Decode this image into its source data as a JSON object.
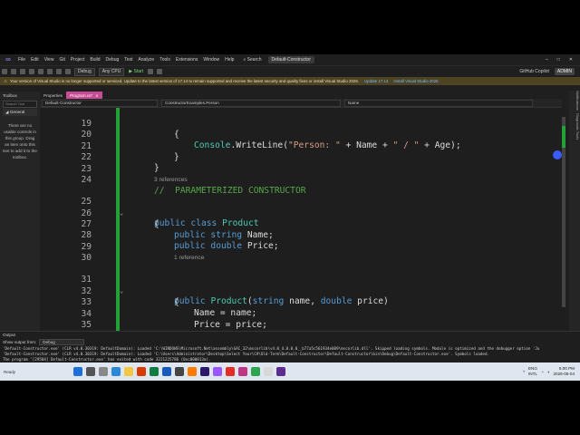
{
  "menu": {
    "items": [
      "File",
      "Edit",
      "View",
      "Git",
      "Project",
      "Build",
      "Debug",
      "Test",
      "Analyze",
      "Tools",
      "Extensions",
      "Window",
      "Help"
    ],
    "search": "Search",
    "solution_title": "Default-Constructor"
  },
  "toolbar": {
    "config": "Debug",
    "platform": "Any CPU",
    "start": "Start",
    "copilot": "GitHub Copilot",
    "user": "ADMIN"
  },
  "warning": {
    "message": "Your version of Visual Studio is no longer supported or serviced. Update to the latest version of 17.14 to remain supported and receive the latest security and quality fixes or install Visual Studio 2026.",
    "link1": "Update 17.14",
    "link2": "Install Visual Studio 2026"
  },
  "toolbox": {
    "title": "Toolbox",
    "search_placeholder": "Search Tool",
    "group": "General",
    "empty_message": "There are no usable controls in this group. Drag an item onto this text to add it to the toolbox."
  },
  "tabs": [
    {
      "label": "Properties"
    },
    {
      "label": "Program.cs*"
    }
  ],
  "navbar": {
    "project": "Default-Constructor",
    "class": "ConstructorExamples.Person",
    "member": "Name"
  },
  "editor": {
    "lines": [
      {
        "n": "19",
        "code": "{"
      },
      {
        "n": "20",
        "code": "Console.WriteLine(\"Person: \" + Name + \" / \" + Age);"
      },
      {
        "n": "21",
        "code": "}"
      },
      {
        "n": "22",
        "code": "}"
      },
      {
        "n": "23",
        "code": ""
      },
      {
        "n": "24",
        "code": "//  PARAMETERIZED CONSTRUCTOR"
      },
      {
        "n": "25",
        "code": "public class Product"
      },
      {
        "n": "26",
        "code": "{"
      },
      {
        "n": "27",
        "code": "public string Name;"
      },
      {
        "n": "28",
        "code": "public double Price;"
      },
      {
        "n": "29",
        "code": ""
      },
      {
        "n": "30",
        "code": ""
      },
      {
        "n": "31",
        "code": "public Product(string name, double price)"
      },
      {
        "n": "32",
        "code": "{"
      },
      {
        "n": "33",
        "code": "Name = name;"
      },
      {
        "n": "34",
        "code": "Price = price;"
      },
      {
        "n": "35",
        "code": "}"
      },
      {
        "n": "36",
        "code": ""
      }
    ],
    "codelens_class": "3 references",
    "codelens_ctor": "1 reference",
    "zoom": "70 %"
  },
  "right_panel": {
    "items": [
      "Notifications",
      "Diagnostic Tools"
    ]
  },
  "output": {
    "title": "Output",
    "show_from_label": "Show output from:",
    "source": "Debug",
    "lines": [
      "'Default-Constructor.exe' (CLR v4.0.30319: DefaultDomain): Loaded 'C:\\WINDOWS\\Microsoft.Net\\assembly\\GAC_32\\mscorlib\\v4.0_4.0.0.0__b77a5c561934e089\\mscorlib.dll'. Skipped loading symbols. Module is optimized and the debugger option 'Ju",
      "'Default-Constructor.exe' (CLR v4.0.30319: DefaultDomain): Loaded 'C:\\Users\\Administrator\\Desktop\\Select Your\\C#\\Old-Term\\Default-Constructor\\Default-Constructor\\bin\\Debug\\Default-Constructor.exe'. Symbols loaded.",
      "The program '[29504] Default-Constructor.exe' has exited with code 3221225786 (0xc000013a)."
    ]
  },
  "taskbar": {
    "status": "Ready",
    "lang": "ENG",
    "region": "INTL",
    "time": "5:00 PM",
    "date": "2026-05-04"
  },
  "colors": {
    "accent_tab": "#c94b96",
    "change_bar": "#23a036",
    "keyword": "#569cd6",
    "type": "#4ec9b0",
    "string": "#d69d85",
    "comment": "#57a64a"
  }
}
